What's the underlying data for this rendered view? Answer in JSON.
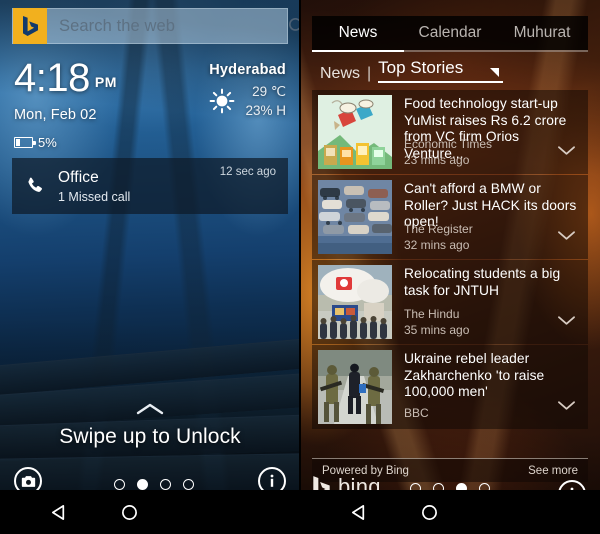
{
  "left_phone": {
    "search": {
      "placeholder": "Search the web",
      "logo_name": "bing-logo",
      "icon": "search-icon"
    },
    "clock": {
      "time": "4:18",
      "meridiem": "PM",
      "date": "Mon, Feb 02",
      "battery": "5%"
    },
    "weather": {
      "city": "Hyderabad",
      "temperature": "29 ℃",
      "humidity": "23% H",
      "icon": "sun-icon"
    },
    "notification": {
      "title": "Office",
      "subtitle": "1 Missed call",
      "time": "12 sec ago",
      "icon": "phone-icon"
    },
    "unlock_hint": "Swipe up to Unlock",
    "camera_button": "camera-icon",
    "info_button": "info-icon",
    "page_dots": {
      "count": 4,
      "active_index": 1
    }
  },
  "right_phone": {
    "tabs": [
      {
        "label": "News",
        "active": true
      },
      {
        "label": "Calendar",
        "active": false
      },
      {
        "label": "Muhurat",
        "active": false
      }
    ],
    "breadcrumb": {
      "root": "News",
      "separator": "|",
      "selected": "Top Stories"
    },
    "stories": [
      {
        "headline": "Food technology start-up YuMist raises Rs 6.2 crore from VC firm Orios Venture...",
        "source": "Economic Times",
        "age": "23 mins ago",
        "thumb": "illustration-food-delivery"
      },
      {
        "headline": "Can't afford a BMW or Roller? Just HACK its doors open!",
        "source": "The Register",
        "age": "32 mins ago",
        "thumb": "photo-parked-cars"
      },
      {
        "headline": "Relocating students a big task for JNTUH",
        "source": "The Hindu",
        "age": "35 mins ago",
        "thumb": "photo-students-crowd"
      },
      {
        "headline": "Ukraine rebel leader Zakharchenko 'to raise 100,000 men'",
        "source": "BBC",
        "age": "",
        "thumb": "photo-soldiers-road"
      }
    ],
    "footer": {
      "powered_by": "Powered by Bing",
      "see_more": "See more"
    },
    "brand": {
      "name": "bing",
      "logo_name": "bing-logo"
    },
    "info_button": "info-icon",
    "page_dots": {
      "count": 4,
      "active_index": 2
    }
  },
  "navigation": {
    "back": "back-icon",
    "home": "home-icon"
  },
  "colors": {
    "bing_gold": "#f2b01e",
    "left_wallpaper": "#1d5283",
    "right_wallpaper": "#7c3a17",
    "accent_white": "#ffffff"
  }
}
